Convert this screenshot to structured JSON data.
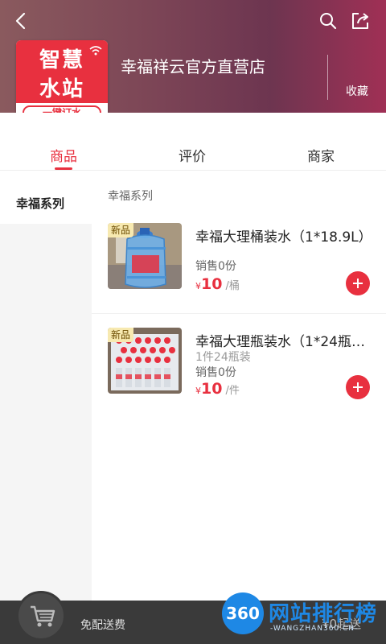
{
  "header": {
    "store_name": "幸福祥云官方直营店",
    "favorite_label": "收藏",
    "logo": {
      "line1": "智慧",
      "line2": "水站",
      "slogan": "一键订水"
    },
    "colors": {
      "accent": "#e8303f"
    }
  },
  "tabs": [
    {
      "label": "商品",
      "active": true
    },
    {
      "label": "评价",
      "active": false
    },
    {
      "label": "商家",
      "active": false
    }
  ],
  "sidebar": {
    "items": [
      {
        "label": "幸福系列",
        "active": true
      }
    ]
  },
  "section": {
    "title": "幸福系列"
  },
  "products": [
    {
      "badge": "新品",
      "name": "幸福大理桶装水（1*18.9L）",
      "spec": "",
      "sales": "销售0份",
      "currency": "¥",
      "price": "10",
      "unit": "/桶",
      "image_icon": "water-barrel-image"
    },
    {
      "badge": "新品",
      "name": "幸福大理瓶装水（1*24瓶…",
      "spec": "1件24瓶装",
      "sales": "销售0份",
      "currency": "¥",
      "price": "10",
      "unit": "/件",
      "image_icon": "bottled-water-pack-image"
    }
  ],
  "bottom_bar": {
    "delivery_text": "免配送费",
    "min_order": "¥0起送"
  },
  "watermark": {
    "badge": "360",
    "title": "网站排行榜",
    "subtitle": "-WANGZHAN360.CN-"
  }
}
